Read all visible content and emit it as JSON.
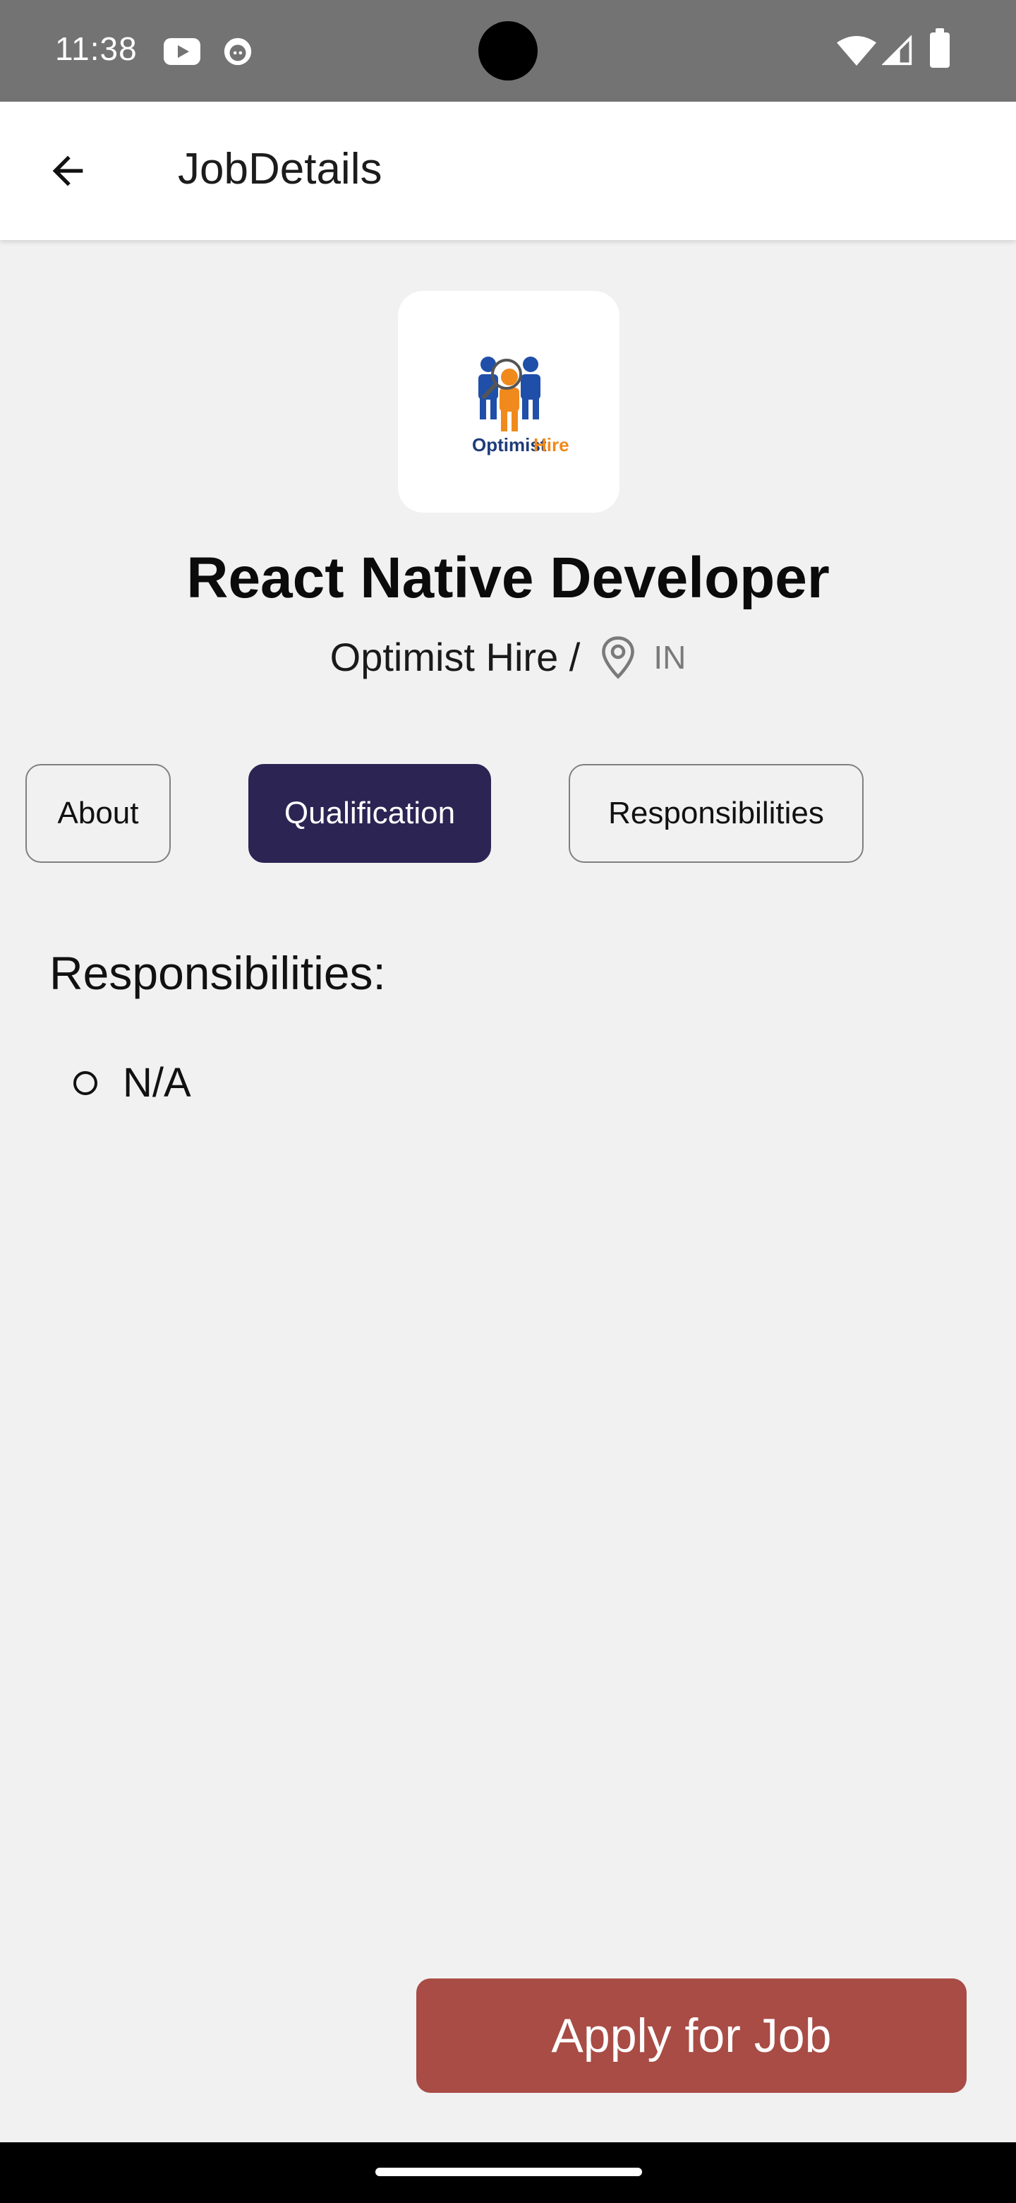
{
  "status_bar": {
    "time": "11:38",
    "icons": [
      "youtube-icon",
      "face-icon",
      "wifi-icon",
      "signal-icon",
      "battery-icon"
    ]
  },
  "app_bar": {
    "title": "JobDetails",
    "back_icon": "arrow-left-icon"
  },
  "job": {
    "logo_text_left": "Optimist",
    "logo_text_right": "Hire",
    "title": "React Native Developer",
    "company": "Optimist Hire /",
    "location": "IN"
  },
  "tabs": [
    {
      "label": "About",
      "active": false
    },
    {
      "label": "Qualification",
      "active": true
    },
    {
      "label": "Responsibilities",
      "active": false
    }
  ],
  "section": {
    "heading": "Responsibilities:",
    "items": [
      "N/A"
    ]
  },
  "apply_button": {
    "label": "Apply for Job"
  },
  "colors": {
    "status_bar": "#737373",
    "active_tab": "#2c2453",
    "apply_button": "#a84c45",
    "background": "#f1f1f1"
  }
}
